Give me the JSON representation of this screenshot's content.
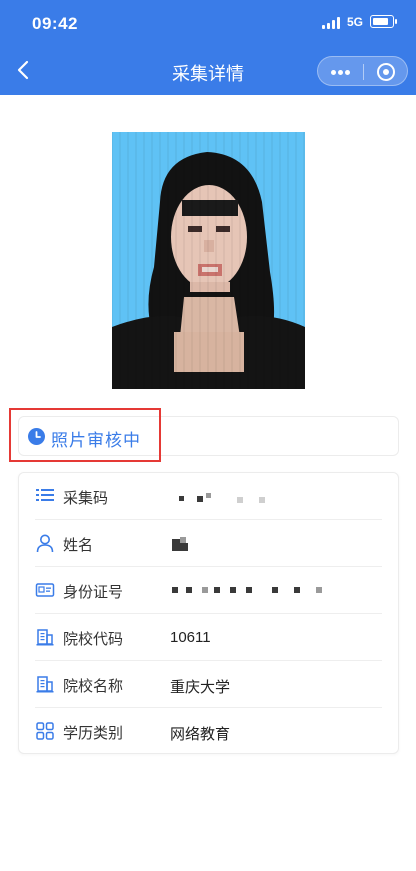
{
  "status_bar": {
    "time": "09:42",
    "network": "5G"
  },
  "nav": {
    "title": "采集详情"
  },
  "colors": {
    "primary": "#3a7ce8",
    "highlight": "#e53935",
    "photo_background": "#5fc2f5"
  },
  "photo": {
    "description": "pixelated-portrait"
  },
  "review": {
    "status": "照片审核中",
    "icon": "clock-icon"
  },
  "info": {
    "rows": [
      {
        "icon": "list-icon",
        "label": "采集码",
        "value": ""
      },
      {
        "icon": "user-icon",
        "label": "姓名",
        "value": ""
      },
      {
        "icon": "id-card-icon",
        "label": "身份证号",
        "value": ""
      },
      {
        "icon": "building-icon",
        "label": "院校代码",
        "value": "10611"
      },
      {
        "icon": "building-icon",
        "label": "院校名称",
        "value": "重庆大学"
      },
      {
        "icon": "category-grid-icon",
        "label": "学历类别",
        "value": "网络教育"
      }
    ]
  }
}
